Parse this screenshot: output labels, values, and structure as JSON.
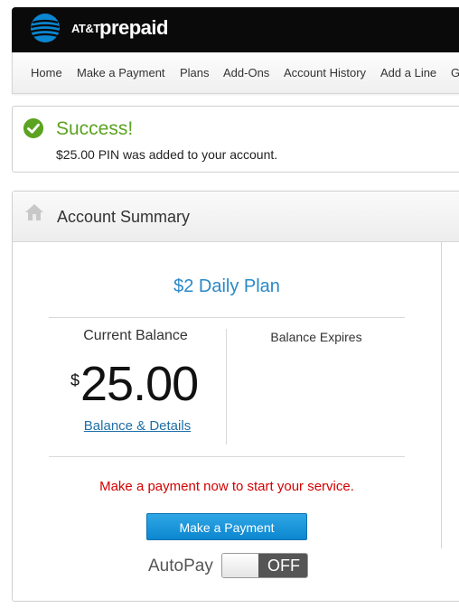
{
  "header": {
    "brand_att": "AT&T",
    "brand_prepaid": "prepaid"
  },
  "nav": {
    "items": [
      "Home",
      "Make a Payment",
      "Plans",
      "Add-Ons",
      "Account History",
      "Add a Line",
      "G"
    ]
  },
  "alert": {
    "title": "Success!",
    "message": "$25.00 PIN was added to your account."
  },
  "summary": {
    "title": "Account Summary",
    "plan_name": "$2 Daily Plan",
    "balance_label": "Current Balance",
    "currency": "$",
    "balance_amount": "25.00",
    "balance_link": "Balance & Details",
    "expires_label": "Balance Expires",
    "warning": "Make a payment now to start your service.",
    "pay_button": "Make a Payment",
    "autopay_label": "AutoPay",
    "autopay_state": "OFF"
  },
  "colors": {
    "success_green": "#5ba321",
    "plan_blue": "#2a88c8",
    "warning_red": "#d40000",
    "button_blue": "#0c86cf"
  },
  "icons": [
    "att-globe-icon",
    "check-circle-icon",
    "home-icon"
  ]
}
